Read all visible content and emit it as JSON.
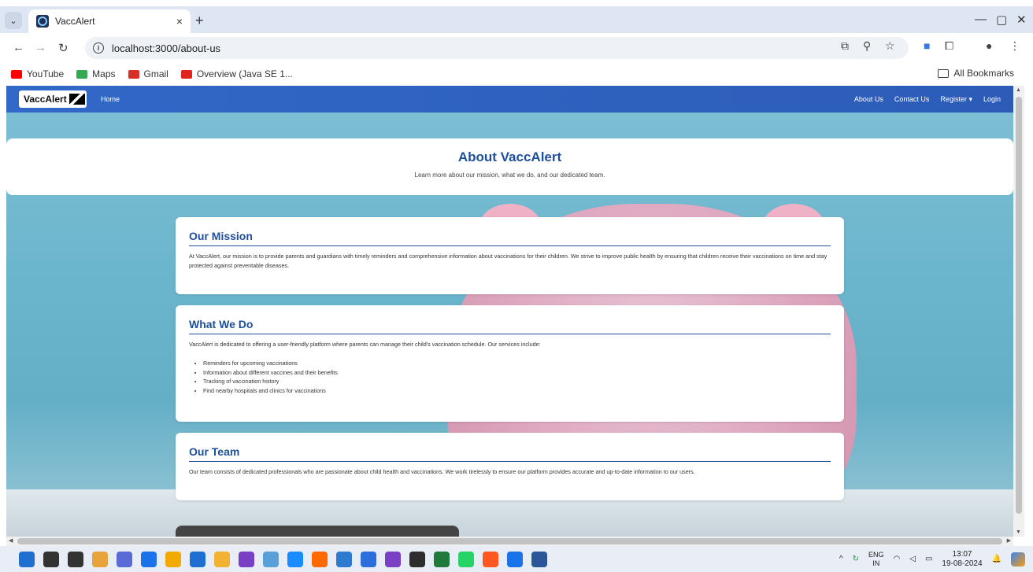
{
  "browser": {
    "tab_title": "VaccAlert",
    "url": "localhost:3000/about-us",
    "new_tab_label": "+",
    "tab_close_label": "×",
    "window_controls": [
      "—",
      "▢",
      "✕"
    ],
    "bookmarks": [
      {
        "label": "YouTube",
        "icon": "youtube-icon",
        "color": "#ff0000"
      },
      {
        "label": "Maps",
        "icon": "maps-icon",
        "color": "#34a853"
      },
      {
        "label": "Gmail",
        "icon": "gmail-icon",
        "color": "#d93025"
      },
      {
        "label": "Overview (Java SE 1...",
        "icon": "oracle-icon",
        "color": "#e2231a"
      }
    ],
    "all_bookmarks_label": "All Bookmarks"
  },
  "navbar": {
    "brand": "VaccAlert",
    "home": "Home",
    "links": [
      "About Us",
      "Contact Us",
      "Register ▾",
      "Login"
    ]
  },
  "hero": {
    "title": "About VaccAlert",
    "subtitle": "Learn more about our mission, what we do, and our dedicated team."
  },
  "sections": {
    "mission": {
      "title": "Our Mission",
      "text": "At VaccAlert, our mission is to provide parents and guardians with timely reminders and comprehensive information about vaccinations for their children. We strive to improve public health by ensuring that children receive their vaccinations on time and stay protected against preventable diseases."
    },
    "what_we_do": {
      "title": "What We Do",
      "text": "VaccAlert is dedicated to offering a user-friendly platform where parents can manage their child's vaccination schedule. Our services include:",
      "items": [
        "Reminders for upcoming vaccinations",
        "Information about different vaccines and their benefits",
        "Tracking of vaccination history",
        "Find nearby hospitals and clinics for vaccinations"
      ]
    },
    "team": {
      "title": "Our Team",
      "text": "Our team consists of dedicated professionals who are passionate about child health and vaccinations. We work tirelessly to ensure our platform provides accurate and up-to-date information to our users."
    }
  },
  "taskbar": {
    "lang": "ENG",
    "region": "IN",
    "time": "13:07",
    "date": "19-08-2024",
    "icon_colors": [
      "#1f6fd1",
      "#333333",
      "#333333",
      "#e8a33a",
      "#5b6bd6",
      "#1a73e8",
      "#f2a900",
      "#1f6fd1",
      "#f2b233",
      "#7b3fc4",
      "#5aa0d8",
      "#1a8cff",
      "#ff6a00",
      "#2f7ad1",
      "#2a6fdb",
      "#7b3fc4",
      "#2d2d2d",
      "#1f7a3b",
      "#25d366",
      "#ff5722",
      "#1a73e8",
      "#2b579a"
    ]
  }
}
